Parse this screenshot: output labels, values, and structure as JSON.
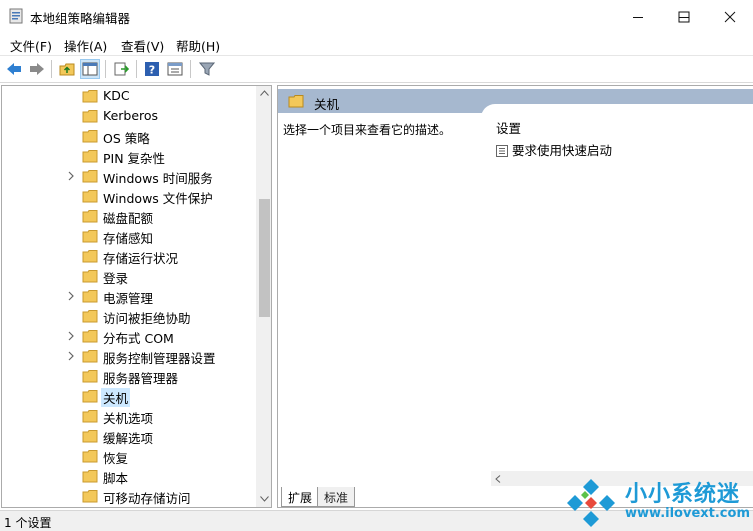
{
  "window": {
    "title": "本地组策略编辑器",
    "minimize": "—",
    "maximize": "☐",
    "close": "✕"
  },
  "menu": [
    "文件(F)",
    "操作(A)",
    "查看(V)",
    "帮助(H)"
  ],
  "toolbar": [
    "back-icon",
    "forward-icon",
    "up-folder-icon",
    "show-hide-tree-icon",
    "export-list-icon",
    "help-icon",
    "properties-icon",
    "filter-icon"
  ],
  "tree": {
    "items": [
      {
        "label": "KDC",
        "expandable": false
      },
      {
        "label": "Kerberos",
        "expandable": false
      },
      {
        "label": "OS 策略",
        "expandable": false
      },
      {
        "label": "PIN 复杂性",
        "expandable": false
      },
      {
        "label": "Windows 时间服务",
        "expandable": true
      },
      {
        "label": "Windows 文件保护",
        "expandable": false
      },
      {
        "label": "磁盘配额",
        "expandable": false
      },
      {
        "label": "存储感知",
        "expandable": false
      },
      {
        "label": "存储运行状况",
        "expandable": false
      },
      {
        "label": "登录",
        "expandable": false
      },
      {
        "label": "电源管理",
        "expandable": true
      },
      {
        "label": "访问被拒绝协助",
        "expandable": false
      },
      {
        "label": "分布式 COM",
        "expandable": true
      },
      {
        "label": "服务控制管理器设置",
        "expandable": true
      },
      {
        "label": "服务器管理器",
        "expandable": false
      },
      {
        "label": "关机",
        "expandable": false,
        "selected": true
      },
      {
        "label": "关机选项",
        "expandable": false
      },
      {
        "label": "缓解选项",
        "expandable": false
      },
      {
        "label": "恢复",
        "expandable": false
      },
      {
        "label": "脚本",
        "expandable": false
      },
      {
        "label": "可移动存储访问",
        "expandable": false
      }
    ]
  },
  "detail": {
    "header": "关机",
    "description": "选择一个项目来查看它的描述。",
    "column_header": "设置",
    "settings": [
      "要求使用快速启动"
    ]
  },
  "tabs": [
    "扩展",
    "标准"
  ],
  "status": "1 个设置",
  "watermark": {
    "name": "小小系统迷",
    "url": "www.ilovext.com"
  },
  "colors": {
    "folder": "#f3c85a",
    "header": "#a6b8cf",
    "selection": "#cce8ff",
    "watermark": "#1e9ad6"
  }
}
